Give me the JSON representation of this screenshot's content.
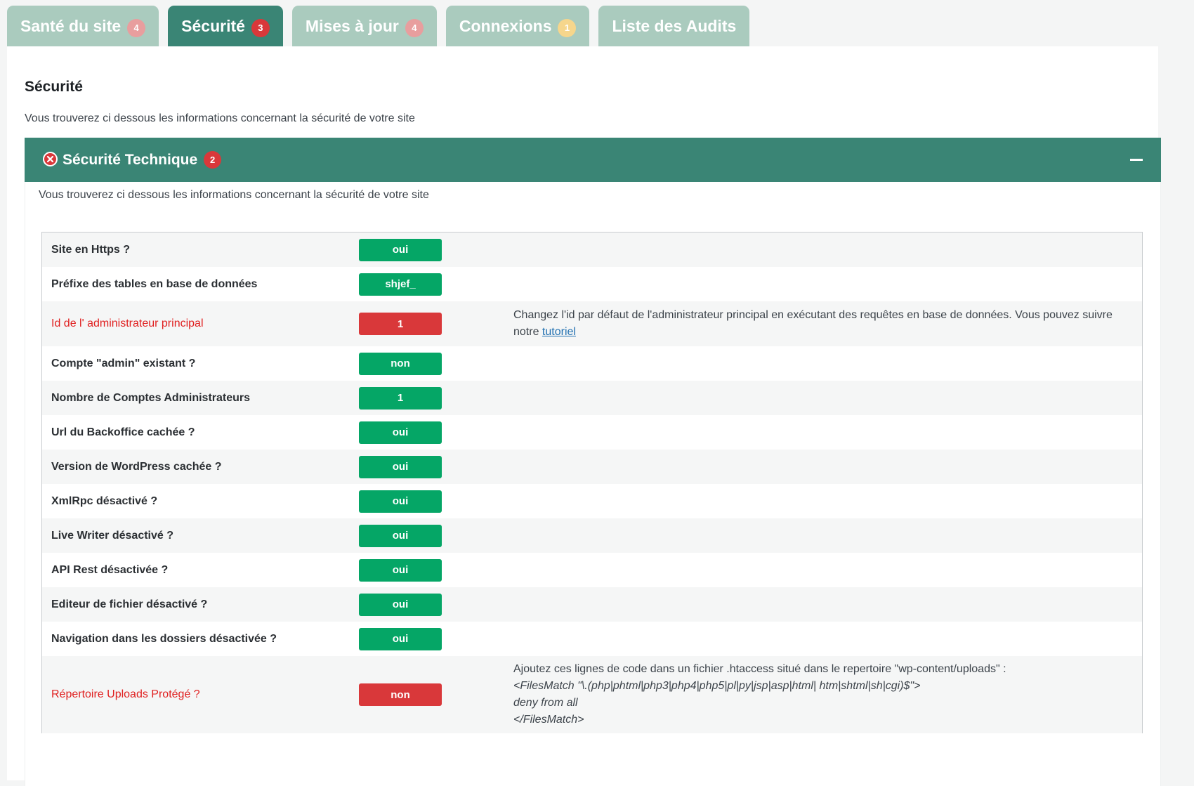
{
  "tabs": [
    {
      "label": "Santé du site",
      "badge": "4",
      "badge_style": "red-pale",
      "active": false
    },
    {
      "label": "Sécurité",
      "badge": "3",
      "badge_style": "red",
      "active": true
    },
    {
      "label": "Mises à jour",
      "badge": "4",
      "badge_style": "red-pale",
      "active": false
    },
    {
      "label": "Connexions",
      "badge": "1",
      "badge_style": "yellow-pale",
      "active": false
    },
    {
      "label": "Liste des Audits",
      "badge": "",
      "badge_style": "",
      "active": false
    }
  ],
  "section": {
    "title": "Sécurité",
    "description": "Vous trouverez ci dessous les informations concernant la sécurité de votre site"
  },
  "accordion": {
    "title": "Sécurité Technique",
    "badge": "2",
    "description": "Vous trouverez ci dessous les informations concernant la sécurité de votre site",
    "status_icon": "error-x-icon",
    "toggle_icon": "minus-icon"
  },
  "rows": [
    {
      "label": "Site en Https ?",
      "value": "oui",
      "status": "ok"
    },
    {
      "label": "Préfixe des tables en base de données",
      "value": "shjef_",
      "status": "ok"
    },
    {
      "label": "Id de l' administrateur principal",
      "value": "1",
      "status": "ko",
      "note": "Changez l'id par défaut de l'administrateur principal en exécutant des requêtes en base de données. Vous pouvez suivre notre",
      "note_link": "tutoriel"
    },
    {
      "label": "Compte \"admin\" existant ?",
      "value": "non",
      "status": "ok"
    },
    {
      "label": "Nombre de Comptes Administrateurs",
      "value": "1",
      "status": "ok"
    },
    {
      "label": "Url du Backoffice cachée ?",
      "value": "oui",
      "status": "ok"
    },
    {
      "label": "Version de WordPress cachée ?",
      "value": "oui",
      "status": "ok"
    },
    {
      "label": "XmlRpc désactivé ?",
      "value": "oui",
      "status": "ok"
    },
    {
      "label": "Live Writer désactivé ?",
      "value": "oui",
      "status": "ok"
    },
    {
      "label": "API Rest désactivée ?",
      "value": "oui",
      "status": "ok"
    },
    {
      "label": "Editeur de fichier désactivé ?",
      "value": "oui",
      "status": "ok"
    },
    {
      "label": "Navigation dans les dossiers désactivée ?",
      "value": "oui",
      "status": "ok"
    },
    {
      "label": "Répertoire Uploads Protégé ?",
      "value": "non",
      "status": "ko",
      "note": "Ajoutez ces lignes de code dans un fichier .htaccess situé dans le repertoire \"wp-content/uploads\" :",
      "code": [
        "<FilesMatch \"\\.(php|phtml|php3|php4|php5|pl|py|jsp|asp|html| htm|shtml|sh|cgi)$\">",
        "deny from all",
        "</FilesMatch>"
      ]
    }
  ],
  "colors": {
    "accent": "#3a8575",
    "tab_inactive": "#aacbbe",
    "ok": "#05a666",
    "ko": "#d9383a",
    "error_text": "#e02020",
    "link": "#2271b1"
  }
}
